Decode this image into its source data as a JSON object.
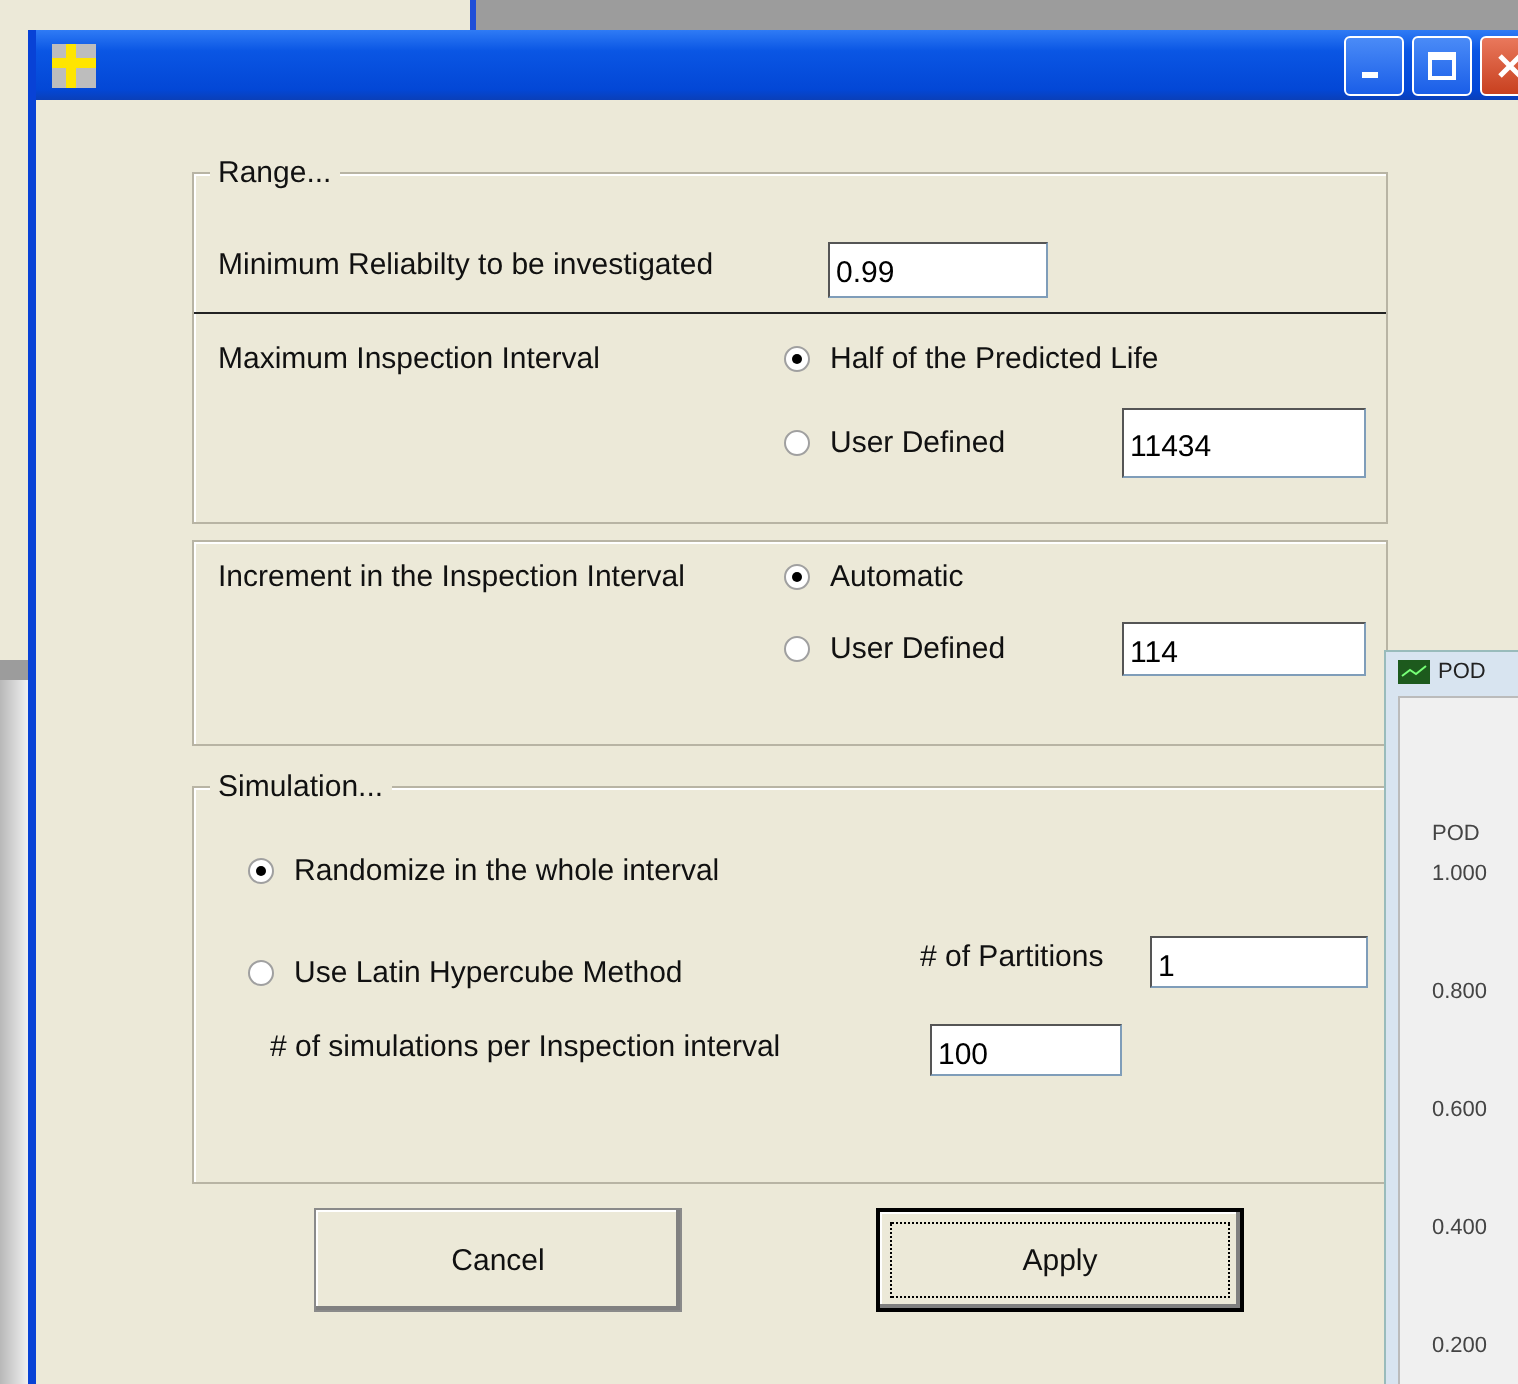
{
  "dialog": {
    "range": {
      "legend": "Range...",
      "min_reliability": {
        "label": "Minimum Reliabilty to be investigated",
        "value": "0.99"
      },
      "max_interval": {
        "label": "Maximum Inspection Interval",
        "options": [
          {
            "label": "Half of the Predicted Life",
            "selected": true
          },
          {
            "label": "User Defined",
            "selected": false
          }
        ],
        "value": "11434"
      }
    },
    "increment": {
      "label": "Increment in the Inspection Interval",
      "options": [
        {
          "label": "Automatic",
          "selected": true
        },
        {
          "label": "User Defined",
          "selected": false
        }
      ],
      "value": "114"
    },
    "simulation": {
      "legend": "Simulation...",
      "options": [
        {
          "label": "Randomize in the whole interval",
          "selected": true
        },
        {
          "label": "Use Latin Hypercube Method",
          "selected": false
        }
      ],
      "partitions": {
        "label": "# of  Partitions",
        "value": "1"
      },
      "simulations": {
        "label": "# of simulations per Inspection interval",
        "value": "100"
      }
    },
    "buttons": [
      {
        "label": "Cancel",
        "default": false
      },
      {
        "label": "Apply",
        "default": true
      }
    ]
  },
  "pod_window": {
    "title": "POD",
    "axis_label": "POD",
    "tick_labels": [
      "1.000",
      "0.800",
      "0.600",
      "0.400",
      "0.200"
    ]
  }
}
